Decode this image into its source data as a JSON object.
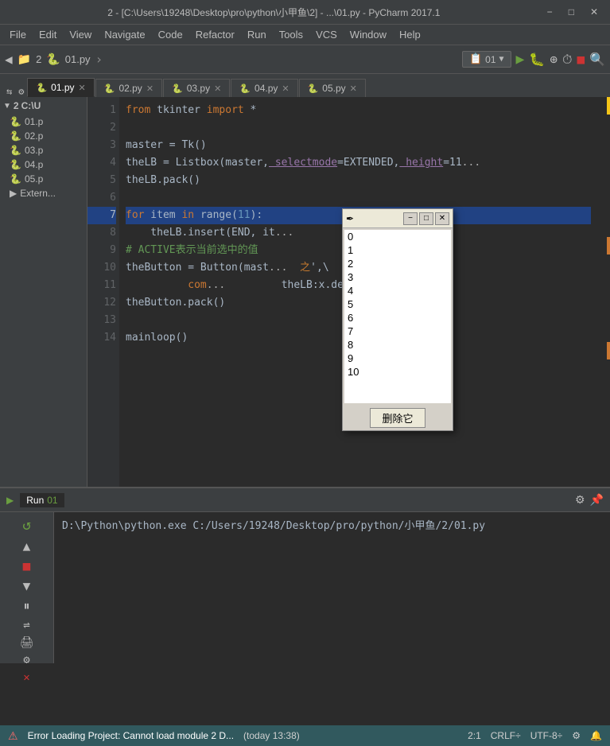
{
  "titlebar": {
    "title": "2 - [C:\\Users\\19248\\Desktop\\pro\\python\\小甲鱼\\2] - ...\\01.py - PyCharm 2017.1",
    "min": "−",
    "max": "□",
    "close": "✕"
  },
  "menubar": {
    "items": [
      "File",
      "Edit",
      "View",
      "Navigate",
      "Code",
      "Refactor",
      "Run",
      "Tools",
      "VCS",
      "Window",
      "Help"
    ]
  },
  "toolbar": {
    "project_label": "2",
    "file_label": "01.py",
    "run_config": "01",
    "settings_icon": "⚙",
    "gear_icon": "⚙"
  },
  "tabs": [
    {
      "id": "01",
      "label": "01.py",
      "active": true
    },
    {
      "id": "02",
      "label": "02.py",
      "active": false
    },
    {
      "id": "03",
      "label": "03.py",
      "active": false
    },
    {
      "id": "04",
      "label": "04.py",
      "active": false
    },
    {
      "id": "05",
      "label": "05.py",
      "active": false
    }
  ],
  "sidebar": {
    "project_label": "2",
    "path": "C:\\U",
    "files": [
      "01.p",
      "02.p",
      "03.p",
      "04.p",
      "05.p"
    ],
    "external_label": "Extern..."
  },
  "code": {
    "lines": [
      {
        "num": 1,
        "text": "from tkinter import *"
      },
      {
        "num": 2,
        "text": ""
      },
      {
        "num": 3,
        "text": "master = Tk()"
      },
      {
        "num": 4,
        "text": "theLB = Listbox(master, selectmode=EXTENDED, height=11..."
      },
      {
        "num": 5,
        "text": "theLB.pack()"
      },
      {
        "num": 6,
        "text": ""
      },
      {
        "num": 7,
        "text": "for item in range(11):"
      },
      {
        "num": 8,
        "text": "    theLB.insert(END, it..."
      },
      {
        "num": 9,
        "text": "# ACTIVE表示当前选中的值"
      },
      {
        "num": 10,
        "text": "theButton = Button(mast..."
      },
      {
        "num": 11,
        "text": "          com..."
      },
      {
        "num": 12,
        "text": "theButton.pack()"
      },
      {
        "num": 13,
        "text": ""
      },
      {
        "num": 14,
        "text": "mainloop()"
      }
    ]
  },
  "float_window": {
    "title": "",
    "feather_icon": "✒",
    "items": [
      "0",
      "1",
      "2",
      "3",
      "4",
      "5",
      "6",
      "7",
      "8",
      "9",
      "10"
    ],
    "button_label": "删除它"
  },
  "run_panel": {
    "tab_label": "Run",
    "run_name": "01",
    "output": "D:\\Python\\python.exe C:/Users/19248/Desktop/pro/python/小甲鱼/2/01.py"
  },
  "statusbar": {
    "error_text": "Error Loading Project: Cannot load module 2 D...",
    "time": "(today 13:38)",
    "position": "2:1",
    "line_sep": "CRLF÷",
    "encoding": "UTF-8÷",
    "icon1": "⚙",
    "icon2": "🔔"
  }
}
